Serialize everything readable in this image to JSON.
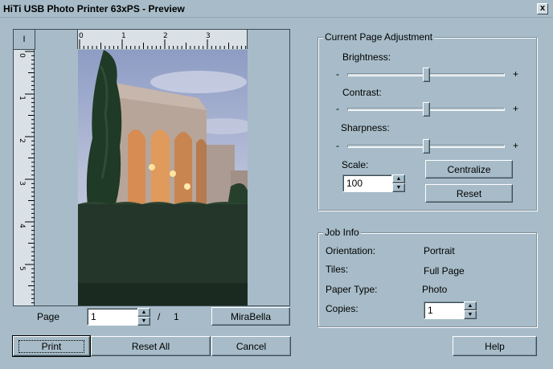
{
  "window": {
    "title": "HiTi USB Photo Printer 63xPS - Preview",
    "close_glyph": "x"
  },
  "preview": {
    "corner_label": "I",
    "ruler_h": [
      "0",
      "1",
      "2",
      "3"
    ],
    "ruler_v": [
      "0",
      "1",
      "2",
      "3",
      "4",
      "5"
    ]
  },
  "page_nav": {
    "label": "Page",
    "current": "1",
    "separator": "/",
    "total": "1",
    "mirabella_button": "MiraBella"
  },
  "adjust": {
    "group_title": "Current Page Adjustment",
    "brightness_label": "Brightness:",
    "contrast_label": "Contrast:",
    "sharpness_label": "Sharpness:",
    "minus": "-",
    "plus": "+",
    "brightness_level": 0.5,
    "contrast_level": 0.5,
    "sharpness_level": 0.5,
    "scale_label": "Scale:",
    "scale_value": "100",
    "centralize_button": "Centralize",
    "reset_button": "Reset"
  },
  "job": {
    "group_title": "Job Info",
    "orientation_label": "Orientation:",
    "orientation_value": "Portrait",
    "tiles_label": "Tiles:",
    "tiles_value": "Full Page",
    "paper_label": "Paper Type:",
    "paper_value": "Photo",
    "copies_label": "Copies:",
    "copies_value": "1"
  },
  "footer": {
    "print_button": "Print",
    "reset_all_button": "Reset All",
    "cancel_button": "Cancel",
    "help_button": "Help"
  },
  "icons": {
    "spin_up": "▲",
    "spin_down": "▼"
  }
}
